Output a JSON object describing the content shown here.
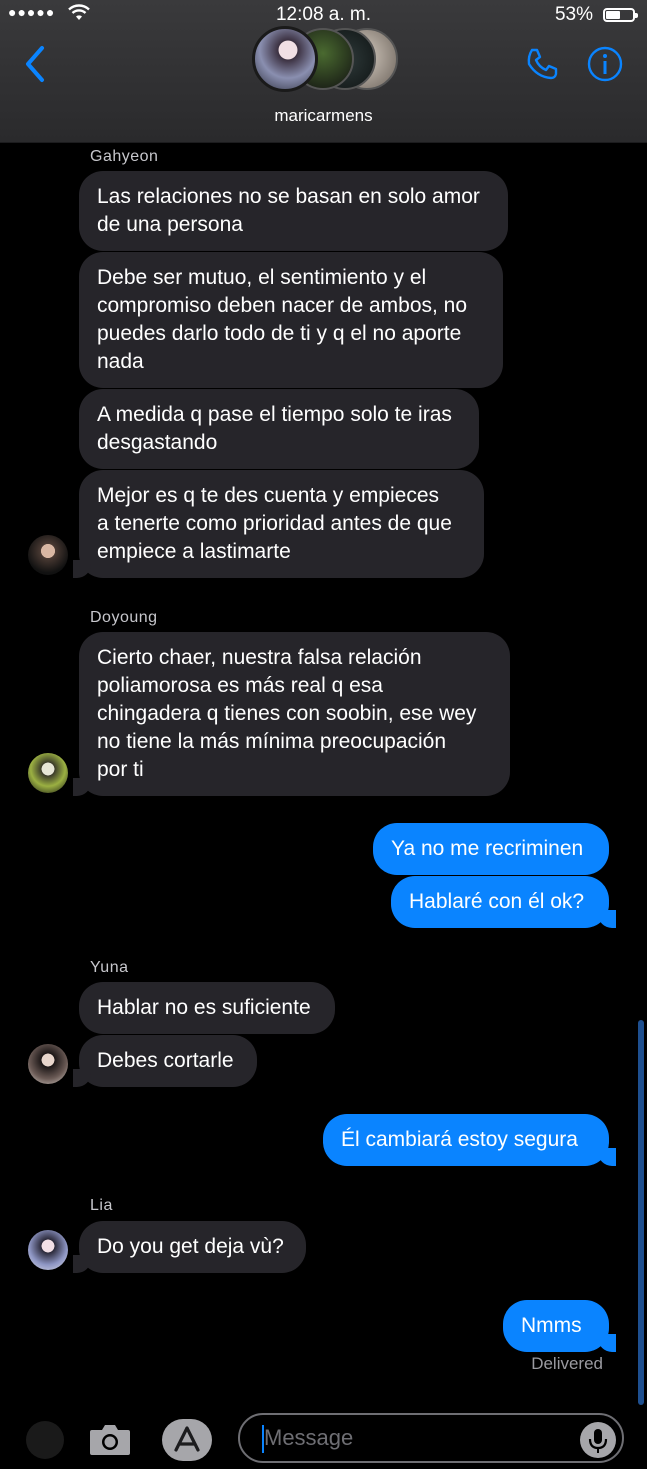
{
  "status_bar": {
    "signal": "●●●●●",
    "time": "12:08 a. m.",
    "battery": "53%"
  },
  "header": {
    "group_name": "maricarmens"
  },
  "messages": {
    "gahyeon": {
      "name": "Gahyeon",
      "m1": "Las relaciones no se basan en solo amor\nde una persona",
      "m2": "Debe ser mutuo, el sentimiento y el\ncompromiso deben nacer de ambos, no\npuedes darlo todo de ti y q el no aporte\nnada",
      "m3": "A medida q pase el tiempo solo te iras\ndesgastando",
      "m4": "Mejor es q te des cuenta y empieces\na tenerte como prioridad antes de que\nempiece a lastimarte"
    },
    "doyoung": {
      "name": "Doyoung",
      "m1": "Cierto chaer, nuestra falsa relación\npoliamorosa es más real q esa\nchingadera q tienes con soobin, ese wey\nno tiene la más mínima preocupación\npor ti"
    },
    "me1": {
      "m1": "Ya no me recriminen",
      "m2": "Hablaré con él ok?"
    },
    "yuna": {
      "name": "Yuna",
      "m1": "Hablar no es suficiente",
      "m2": "Debes cortarle"
    },
    "me2": {
      "m1": "Él cambiará estoy segura"
    },
    "lia": {
      "name": "Lia",
      "m1": "Do you get deja vù?"
    },
    "me3": {
      "m1": "Nmms",
      "status": "Delivered"
    }
  },
  "compose": {
    "placeholder": "Message"
  },
  "colors": {
    "outgoing": "#0a84ff",
    "incoming": "#26252a",
    "accent": "#0a84ff"
  },
  "icons": [
    "back-chevron-icon",
    "phone-icon",
    "info-icon",
    "camera-icon",
    "app-store-icon",
    "microphone-icon",
    "wifi-icon",
    "battery-icon"
  ]
}
